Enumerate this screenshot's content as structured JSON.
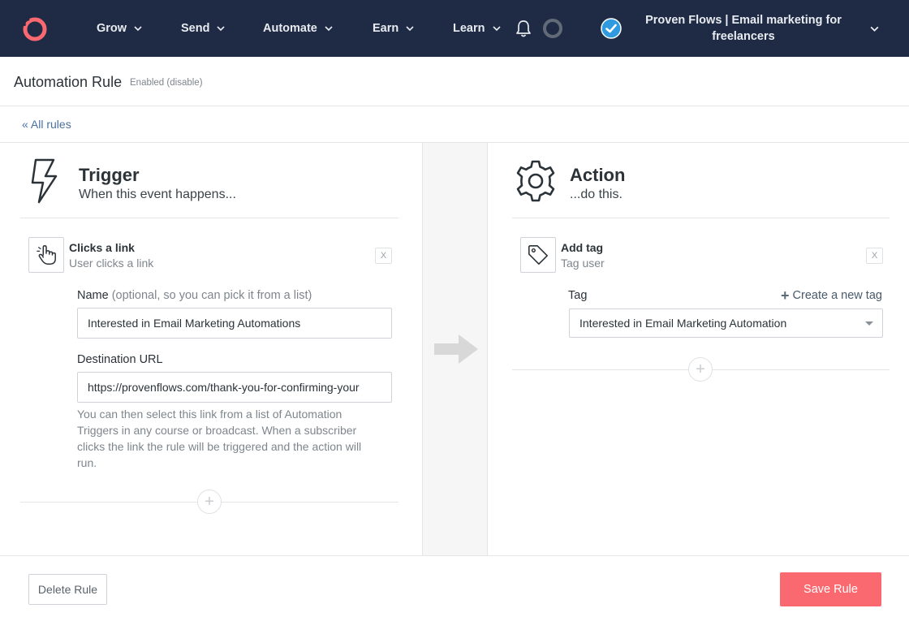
{
  "nav": {
    "logo_icon": "convertkit-logo-icon",
    "items": [
      {
        "label": "Grow"
      },
      {
        "label": "Send"
      },
      {
        "label": "Automate"
      },
      {
        "label": "Earn"
      },
      {
        "label": "Learn"
      }
    ],
    "account_name": "Proven Flows | Email marketing for freelancers"
  },
  "header": {
    "title": "Automation Rule",
    "status_prefix": "Enabled",
    "status_link": "(disable)"
  },
  "breadcrumb": {
    "label": "« All rules"
  },
  "trigger": {
    "title": "Trigger",
    "subtitle": "When this event happens...",
    "step_title": "Clicks a link",
    "step_subtitle": "User clicks a link",
    "remove_label": "X",
    "name_label": "Name",
    "name_hint": "(optional, so you can pick it from a list)",
    "name_value": "Interested in Email Marketing Automations",
    "url_label": "Destination URL",
    "url_value": "https://provenflows.com/thank-you-for-confirming-your",
    "help_lines": [
      "You can then select this link from a list of Automation",
      "Triggers in any course or broadcast. When a subscriber",
      "clicks the link the rule will be triggered and the action will",
      "run."
    ],
    "add_label": "+"
  },
  "action": {
    "title": "Action",
    "subtitle": "...do this.",
    "step_title": "Add tag",
    "step_subtitle": "Tag user",
    "remove_label": "X",
    "tag_label": "Tag",
    "create_tag_plus": "+",
    "create_tag_label": "Create a new tag",
    "tag_value": "Interested in Email Marketing Automation",
    "add_label": "+"
  },
  "footer": {
    "delete_label": "Delete Rule",
    "save_label": "Save Rule"
  },
  "colors": {
    "nav_bg": "#1f2b45",
    "save_button": "#fb6970",
    "logo": "#fb6970",
    "verified": "#2f9ae0"
  }
}
